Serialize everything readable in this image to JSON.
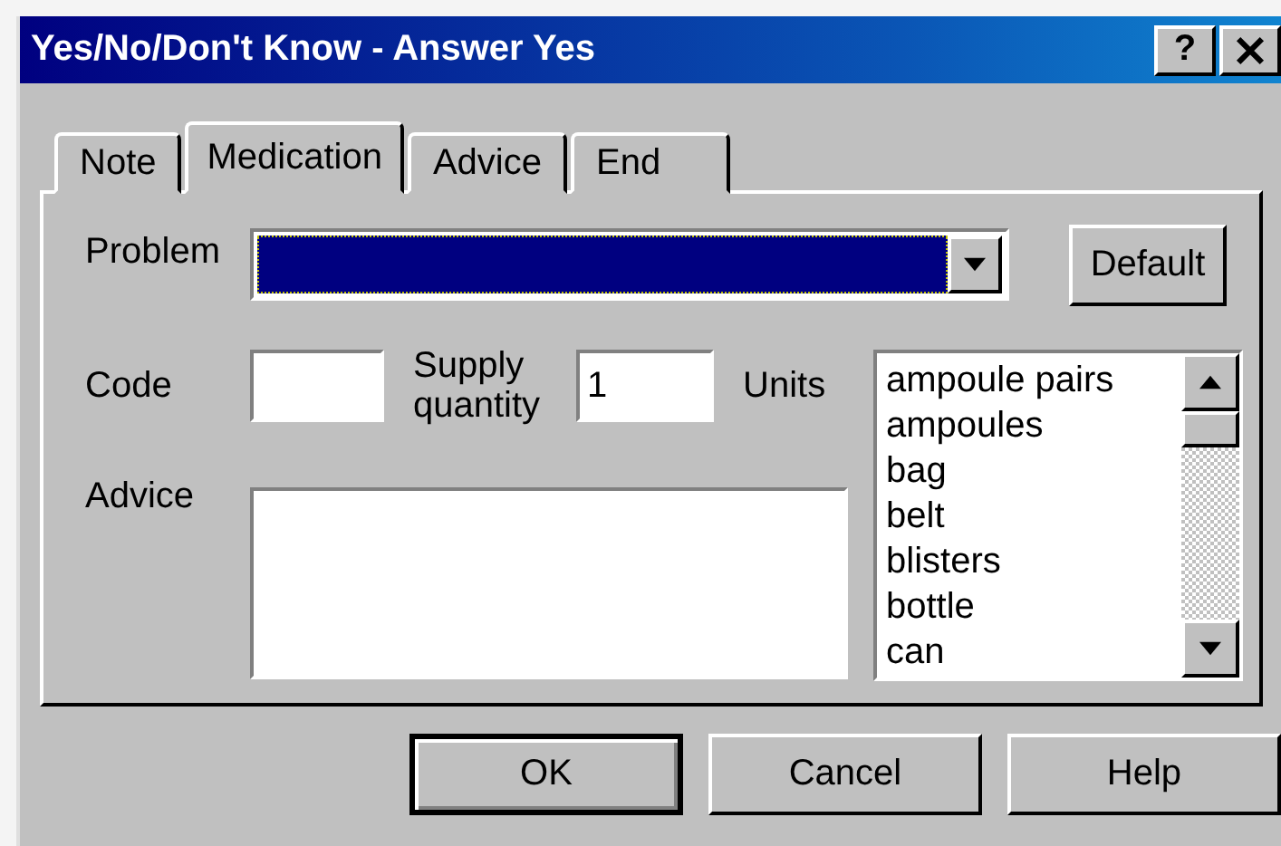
{
  "window": {
    "title": "Yes/No/Don't Know - Answer Yes",
    "help_button": "?"
  },
  "tabs": [
    {
      "label": "Note",
      "selected": false
    },
    {
      "label": "Medication",
      "selected": true
    },
    {
      "label": "Advice",
      "selected": false
    },
    {
      "label": "End",
      "selected": false
    }
  ],
  "problem": {
    "label": "Problem",
    "highlighted": true
  },
  "default_button": "Default",
  "code": {
    "label": "Code"
  },
  "supply_quantity": {
    "label": "Supply quantity",
    "value": "1"
  },
  "units": {
    "label": "Units",
    "items": [
      "ampoule pairs",
      "ampoules",
      "bag",
      "belt",
      "blisters",
      "bottle",
      "can"
    ]
  },
  "advice": {
    "label": "Advice"
  },
  "buttons": [
    {
      "label": "OK",
      "default": true
    },
    {
      "label": "Cancel",
      "default": false
    },
    {
      "label": "Help",
      "default": false
    }
  ]
}
